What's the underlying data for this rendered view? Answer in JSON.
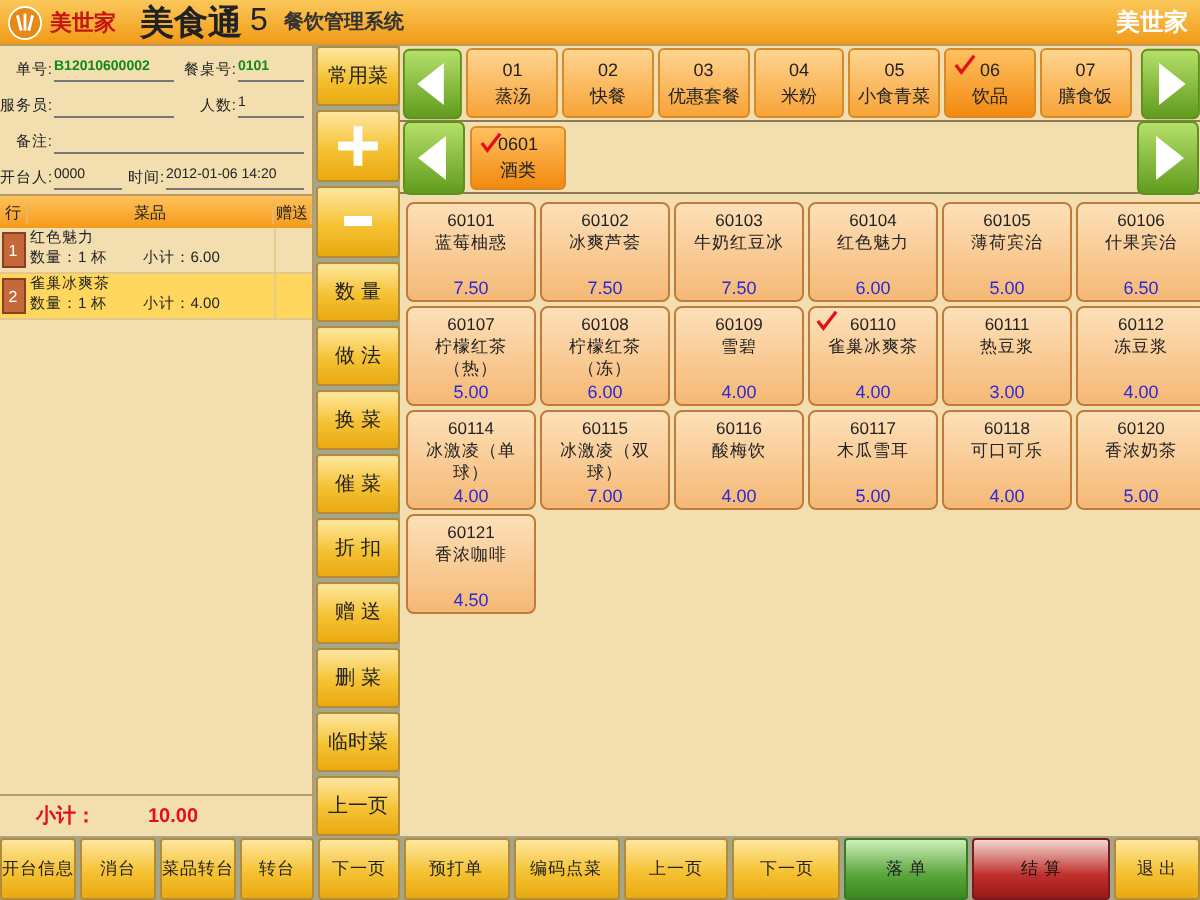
{
  "title": {
    "brand": "美世家",
    "product": "美食通",
    "version": "5",
    "subtitle": "餐饮管理系统",
    "right_brand": "美世家"
  },
  "order_info": [
    {
      "label": "单号:",
      "value": "B12010600002"
    },
    {
      "label": "餐桌号:",
      "value": "0101"
    },
    {
      "label": "服务员:"
    },
    {
      "label": "人数:",
      "value": "1"
    },
    {
      "label": "备注:"
    },
    {
      "label": "开台人:",
      "value": "0000"
    },
    {
      "label": "时间:",
      "value": "2012-01-06 14:20"
    }
  ],
  "order_table": {
    "columns": [
      "行",
      "菜品",
      "赠送"
    ],
    "rows": [
      {
        "line": "1",
        "name": "红色魅力",
        "quantity": "数量：1 杯",
        "subtotal": "小计：6.00",
        "selected": false
      },
      {
        "line": "2",
        "name": "雀巢冰爽茶",
        "quantity": "数量：1 杯",
        "subtotal": "小计：4.00",
        "selected": true
      }
    ]
  },
  "total": {
    "label": "小计：",
    "value": "10.00"
  },
  "side_buttons": [
    {
      "kind": "text",
      "label": "常用菜"
    },
    {
      "kind": "plus"
    },
    {
      "kind": "minus"
    },
    {
      "kind": "text",
      "label": "数 量"
    },
    {
      "kind": "text",
      "label": "做 法"
    },
    {
      "kind": "text",
      "label": "换 菜"
    },
    {
      "kind": "text",
      "label": "催 菜"
    },
    {
      "kind": "text",
      "label": "折 扣"
    },
    {
      "kind": "text",
      "label": "赠 送"
    },
    {
      "kind": "text",
      "label": "删 菜"
    },
    {
      "kind": "text",
      "label": "临时菜"
    },
    {
      "kind": "text",
      "label": "上一页"
    }
  ],
  "categories": [
    {
      "code": "01",
      "name": "蒸汤",
      "selected": false
    },
    {
      "code": "02",
      "name": "快餐",
      "selected": false
    },
    {
      "code": "03",
      "name": "优惠套餐",
      "selected": false
    },
    {
      "code": "04",
      "name": "米粉",
      "selected": false
    },
    {
      "code": "05",
      "name": "小食青菜",
      "selected": false
    },
    {
      "code": "06",
      "name": "饮品",
      "selected": true
    },
    {
      "code": "07",
      "name": "膳食饭",
      "selected": false
    }
  ],
  "subcategories": [
    {
      "code": "0601",
      "name": "酒类",
      "selected": true
    }
  ],
  "dishes": [
    {
      "code": "60101",
      "name": "蓝莓柚惑",
      "price": "7.50",
      "selected": false
    },
    {
      "code": "60102",
      "name": "冰爽芦荟",
      "price": "7.50",
      "selected": false
    },
    {
      "code": "60103",
      "name": "牛奶红豆冰",
      "price": "7.50",
      "selected": false
    },
    {
      "code": "60104",
      "name": "红色魅力",
      "price": "6.00",
      "selected": false
    },
    {
      "code": "60105",
      "name": "薄荷宾治",
      "price": "5.00",
      "selected": false
    },
    {
      "code": "60106",
      "name": "什果宾治",
      "price": "6.50",
      "selected": false
    },
    {
      "code": "60107",
      "name": "柠檬红茶（热）",
      "price": "5.00",
      "selected": false
    },
    {
      "code": "60108",
      "name": "柠檬红茶（冻）",
      "price": "6.00",
      "selected": false
    },
    {
      "code": "60109",
      "name": "雪碧",
      "price": "4.00",
      "selected": false
    },
    {
      "code": "60110",
      "name": "雀巢冰爽茶",
      "price": "4.00",
      "selected": true
    },
    {
      "code": "60111",
      "name": "热豆浆",
      "price": "3.00",
      "selected": false
    },
    {
      "code": "60112",
      "name": "冻豆浆",
      "price": "4.00",
      "selected": false
    },
    {
      "code": "60114",
      "name": "冰激凌（单球）",
      "price": "4.00",
      "selected": false
    },
    {
      "code": "60115",
      "name": "冰激凌（双球）",
      "price": "7.00",
      "selected": false
    },
    {
      "code": "60116",
      "name": "酸梅饮",
      "price": "4.00",
      "selected": false
    },
    {
      "code": "60117",
      "name": "木瓜雪耳",
      "price": "5.00",
      "selected": false
    },
    {
      "code": "60118",
      "name": "可口可乐",
      "price": "4.00",
      "selected": false
    },
    {
      "code": "60120",
      "name": "香浓奶茶",
      "price": "5.00",
      "selected": false
    },
    {
      "code": "60121",
      "name": "香浓咖啡",
      "price": "4.50",
      "selected": false
    }
  ],
  "bottom_buttons": [
    {
      "label": "开台信息",
      "kind": "normal"
    },
    {
      "label": "消台",
      "kind": "normal"
    },
    {
      "label": "菜品转台",
      "kind": "normal"
    },
    {
      "label": "转台",
      "kind": "normal"
    },
    {
      "label": "下一页",
      "kind": "normal"
    },
    {
      "label": "预打单",
      "kind": "normal"
    },
    {
      "label": "编码点菜",
      "kind": "normal"
    },
    {
      "label": "上一页",
      "kind": "normal"
    },
    {
      "label": "下一页",
      "kind": "normal"
    },
    {
      "label": "落 单",
      "kind": "green"
    },
    {
      "label": "结 算",
      "kind": "red"
    },
    {
      "label": "退 出",
      "kind": "normal"
    }
  ]
}
